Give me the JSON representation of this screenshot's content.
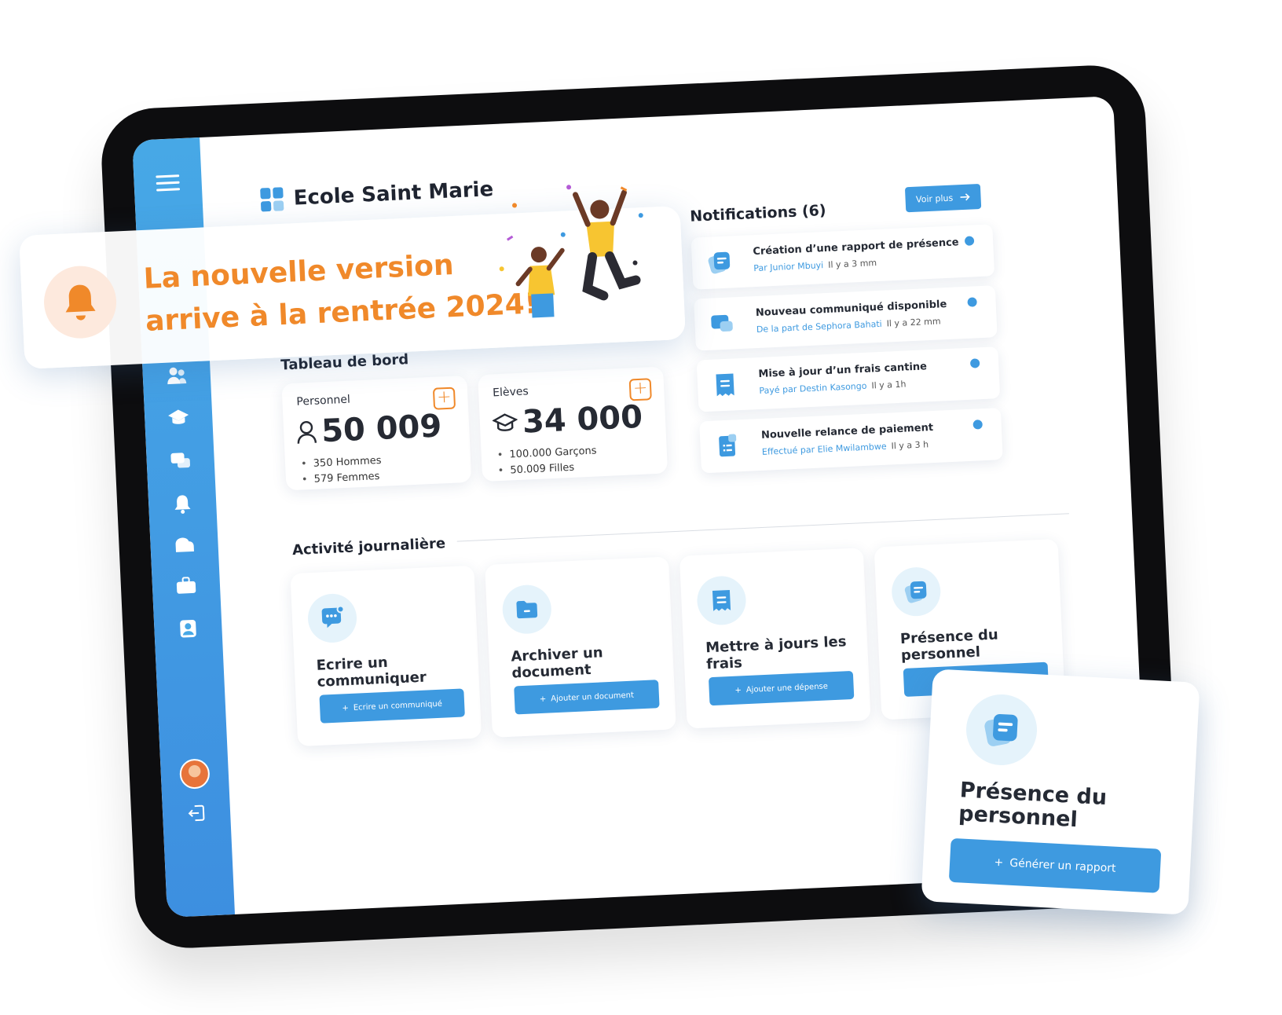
{
  "app": {
    "school_name": "Ecole Saint Marie"
  },
  "banner": {
    "line1": "La nouvelle version",
    "line2": "arrive à la rentrée 2024!",
    "icon": "bell-icon"
  },
  "dashboard": {
    "title": "Tableau de bord",
    "stats": [
      {
        "label": "Personnel",
        "value": "50 009",
        "icon": "user-icon",
        "details": [
          "350 Hommes",
          "579 Femmes"
        ]
      },
      {
        "label": "Elèves",
        "value": "34 000",
        "icon": "graduation-cap-icon",
        "details": [
          "100.000 Garçons",
          "50.009 Filles"
        ]
      }
    ]
  },
  "notifications": {
    "title": "Notifications (6)",
    "more_label": "Voir plus",
    "items": [
      {
        "title": "Création d’une rapport de présence",
        "by": "Par Junior Mbuyi",
        "time": "Il y a 3 mm",
        "icon": "report-icon"
      },
      {
        "title": "Nouveau communiqué disponible",
        "by": "De la part de Sephora Bahati",
        "time": "Il y a 22 mm",
        "icon": "message-icon"
      },
      {
        "title": "Mise à jour d’un frais cantine",
        "by": "Payé par Destin Kasongo",
        "time": "Il y a 1h",
        "icon": "receipt-icon"
      },
      {
        "title": "Nouvelle relance de paiement",
        "by": "Effectué par Elie Mwilambwe",
        "time": "Il y a 3 h",
        "icon": "list-icon"
      }
    ]
  },
  "activity": {
    "title": "Activité journalière",
    "cards": [
      {
        "title": "Ecrire un communiquer",
        "button": "Ecrire un communiqué",
        "icon": "chat-icon"
      },
      {
        "title": "Archiver un document",
        "button": "Ajouter un document",
        "icon": "folder-icon"
      },
      {
        "title": "Mettre à jours les frais",
        "button": "Ajouter une dépense",
        "icon": "receipt-icon"
      },
      {
        "title": "Présence du personnel",
        "button": "",
        "icon": "report-icon"
      }
    ]
  },
  "floating_card": {
    "title": "Présence du personnel",
    "button": "Générer un rapport",
    "icon": "report-icon"
  },
  "colors": {
    "primary": "#3e9ae0",
    "accent": "#f0892a",
    "sidebar_top": "#47a8e6",
    "sidebar_bottom": "#3d8fe0"
  }
}
